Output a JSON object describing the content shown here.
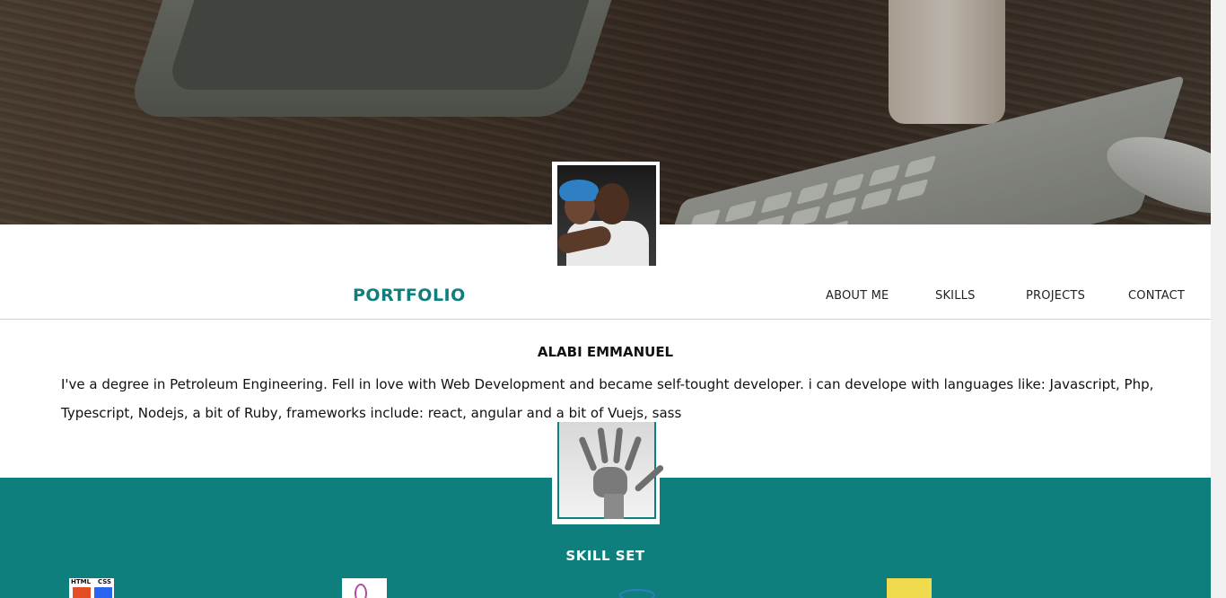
{
  "nav": {
    "brand": "PORTFOLIO",
    "links": [
      "ABOUT ME",
      "SKILLS",
      "PROJECTS",
      "CONTACT"
    ]
  },
  "about": {
    "name": "ALABI EMMANUEL",
    "bio_line1": "I've a degree in Petroleum Engineering. Fell in love with Web Development and became self-tought developer. i can develope with languages like: Javascript, Php,",
    "bio_line2": "Typescript, Nodejs, a bit of Ruby, frameworks include: react, angular and a bit of Vuejs, sass"
  },
  "skills": {
    "title": "SKILL SET",
    "icons": [
      {
        "name": "html-css-icon",
        "badge_top": "HTML",
        "badge_right": "CSS"
      },
      {
        "name": "php-icon"
      },
      {
        "name": "react-icon"
      },
      {
        "name": "javascript-icon"
      }
    ]
  },
  "colors": {
    "accent": "#0e7f7c",
    "text": "#111111",
    "nav_border": "#cfcfcf"
  }
}
